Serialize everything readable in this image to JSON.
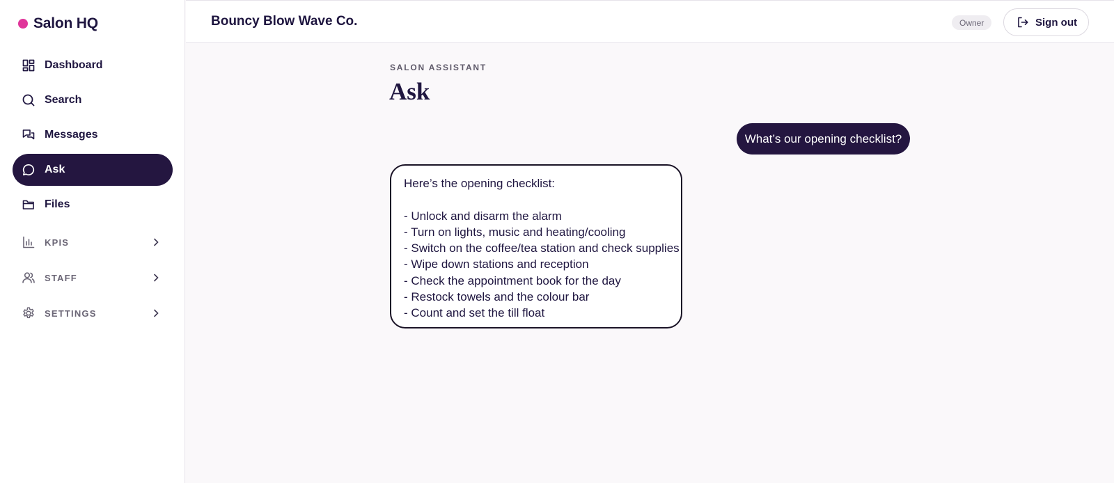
{
  "app": {
    "name": "Salon HQ",
    "brand_color": "#e0359a",
    "accent_color": "#241640"
  },
  "sidebar": {
    "items": [
      {
        "label": "Dashboard",
        "icon": "dashboard-icon",
        "active": false
      },
      {
        "label": "Search",
        "icon": "search-icon",
        "active": false
      },
      {
        "label": "Messages",
        "icon": "messages-icon",
        "active": false
      },
      {
        "label": "Ask",
        "icon": "chat-bubble-icon",
        "active": true
      },
      {
        "label": "Files",
        "icon": "folder-icon",
        "active": false
      }
    ],
    "groups": [
      {
        "label": "KPIS",
        "icon": "bar-chart-icon"
      },
      {
        "label": "STAFF",
        "icon": "users-icon"
      },
      {
        "label": "SETTINGS",
        "icon": "gear-icon"
      }
    ]
  },
  "header": {
    "salon_name": "Bouncy Blow Wave Co.",
    "role_badge": "Owner",
    "signout_label": "Sign out"
  },
  "main": {
    "eyebrow": "SALON ASSISTANT",
    "title": "Ask",
    "conversation": {
      "user_message": "What’s our opening checklist?",
      "assistant_lines": [
        "Here’s the opening checklist:",
        "",
        "- Unlock and disarm the alarm",
        "- Turn on lights, music and heating/cooling",
        "- Switch on the coffee/tea station and check supplies",
        "- Wipe down stations and reception",
        "- Check the appointment book for the day",
        "- Restock towels and the colour bar",
        "- Count and set the till float"
      ]
    }
  }
}
